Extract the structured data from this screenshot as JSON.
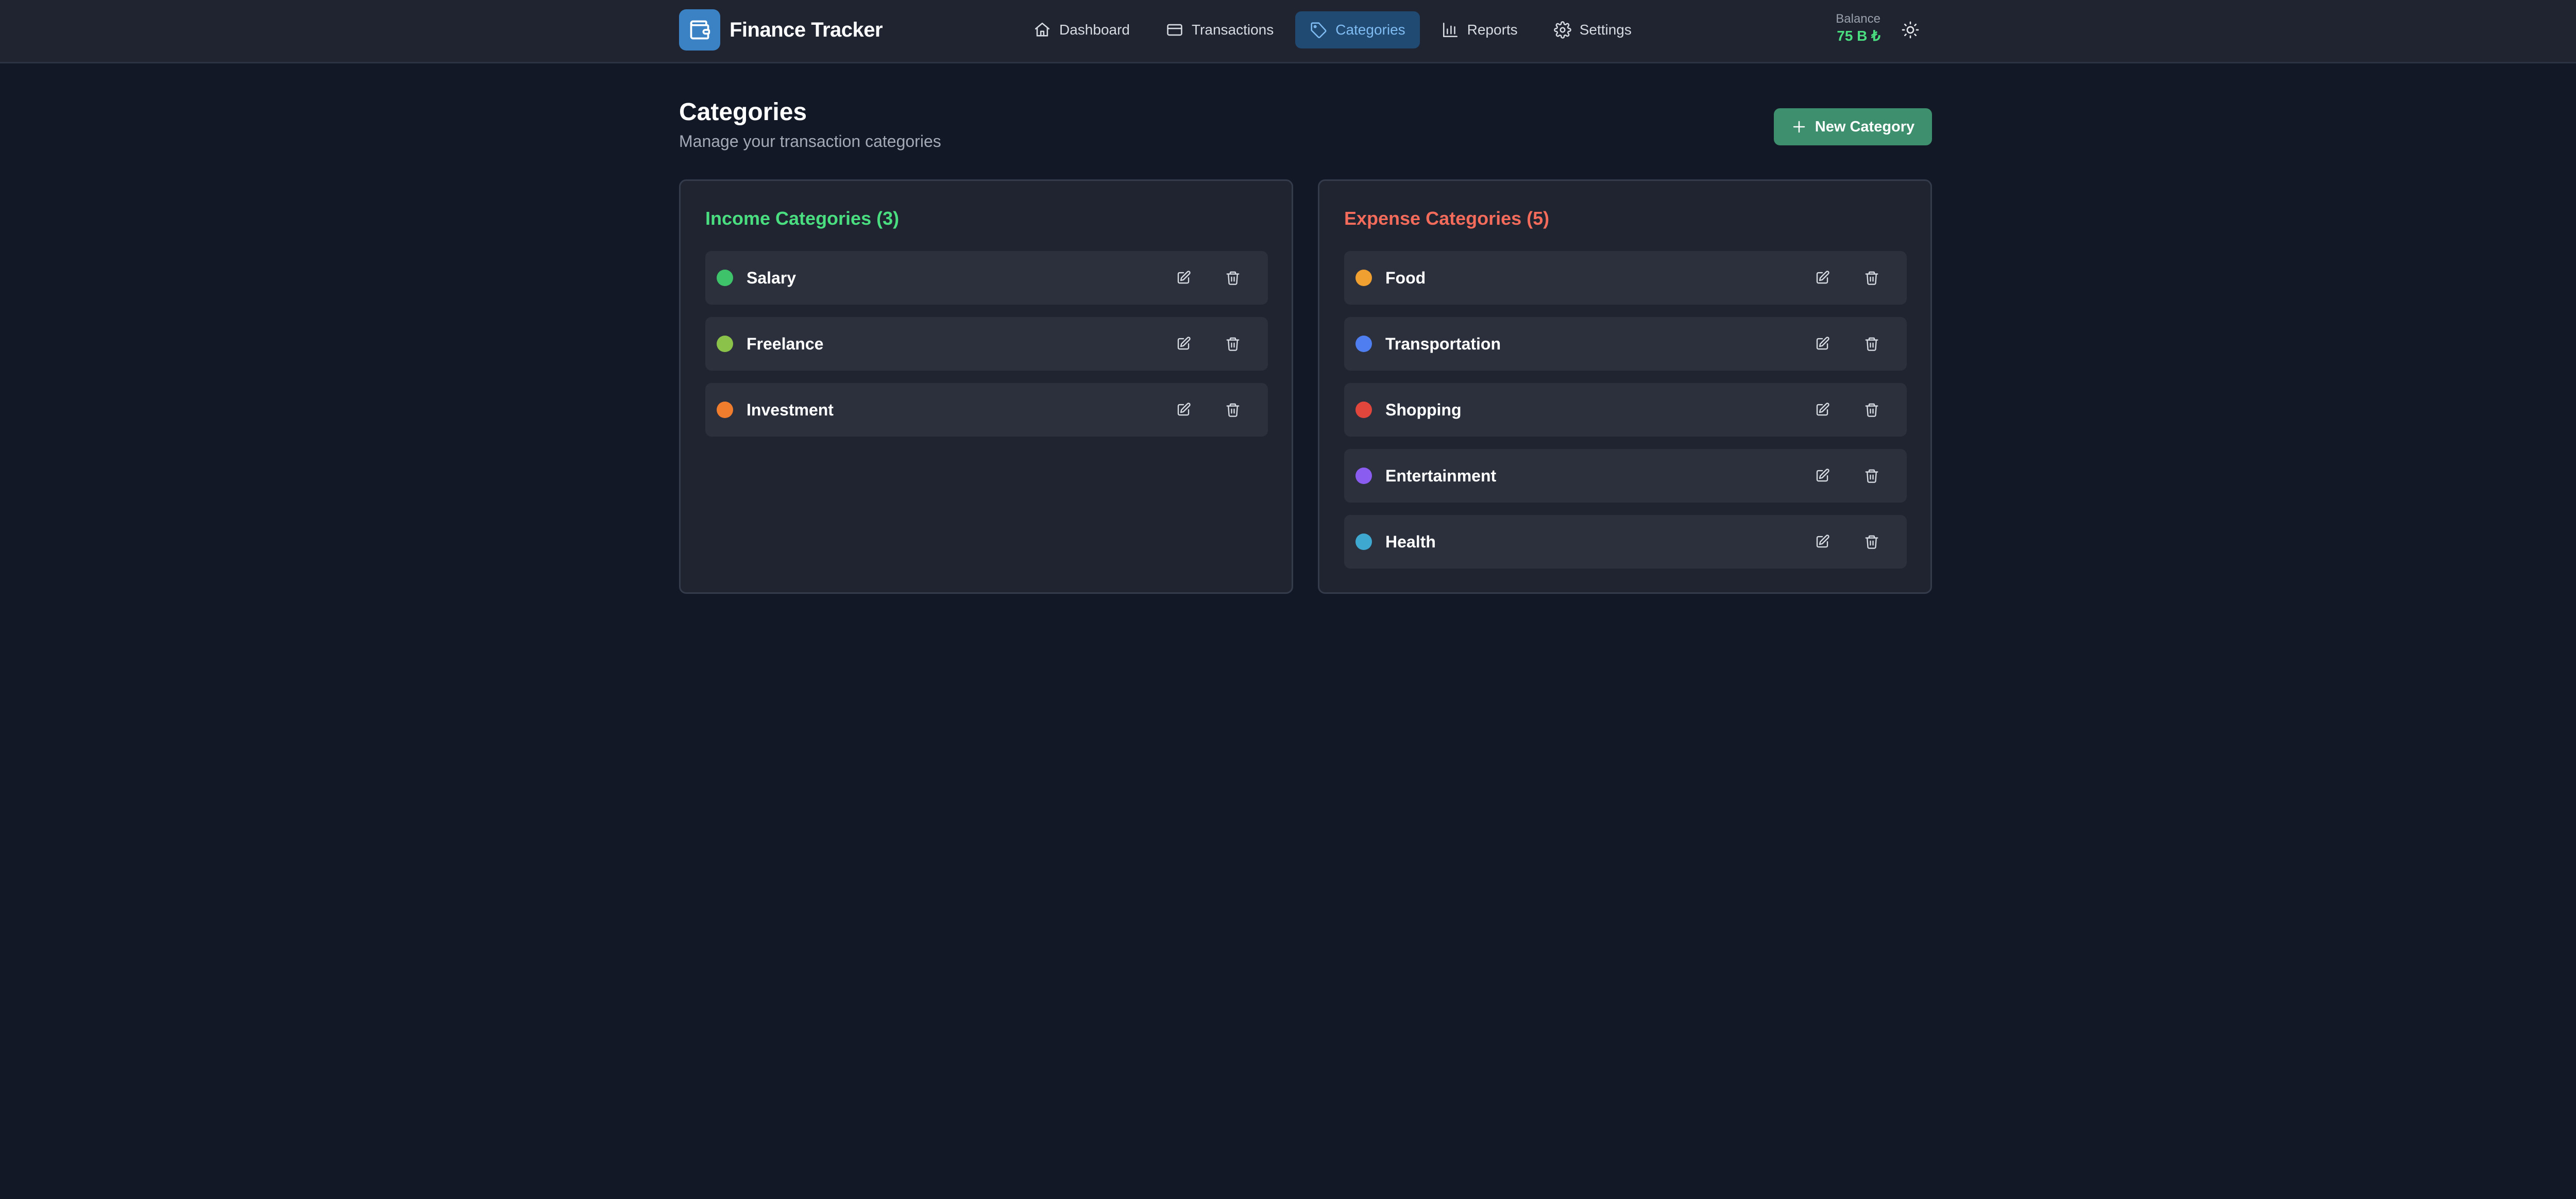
{
  "app": {
    "title": "Finance Tracker",
    "logo_icon": "wallet-icon"
  },
  "nav": {
    "items": [
      {
        "label": "Dashboard",
        "icon": "home-icon"
      },
      {
        "label": "Transactions",
        "icon": "credit-card-icon"
      },
      {
        "label": "Categories",
        "icon": "tag-icon",
        "active": true
      },
      {
        "label": "Reports",
        "icon": "bar-chart-icon"
      },
      {
        "label": "Settings",
        "icon": "gear-icon"
      }
    ]
  },
  "balance": {
    "label": "Balance",
    "value": "75 B ₺"
  },
  "theme_toggle": {
    "icon": "sun-icon"
  },
  "page": {
    "title": "Categories",
    "subtitle": "Manage your transaction categories",
    "new_button_label": "New Category"
  },
  "income": {
    "title": "Income Categories (3)",
    "items": [
      {
        "name": "Salary",
        "color": "#3ec26a"
      },
      {
        "name": "Freelance",
        "color": "#8bc34a"
      },
      {
        "name": "Investment",
        "color": "#f07c2e"
      }
    ]
  },
  "expense": {
    "title": "Expense Categories (5)",
    "items": [
      {
        "name": "Food",
        "color": "#f0a030"
      },
      {
        "name": "Transportation",
        "color": "#4f7ef0"
      },
      {
        "name": "Shopping",
        "color": "#e0463c"
      },
      {
        "name": "Entertainment",
        "color": "#8a5cf0"
      },
      {
        "name": "Health",
        "color": "#3fa8d0"
      }
    ]
  },
  "colors": {
    "background": "#121826",
    "header": "#1f2430",
    "accent_active": "#214a73",
    "income": "#4ade80",
    "expense": "#f26b5b",
    "button": "#3e8f6d"
  }
}
